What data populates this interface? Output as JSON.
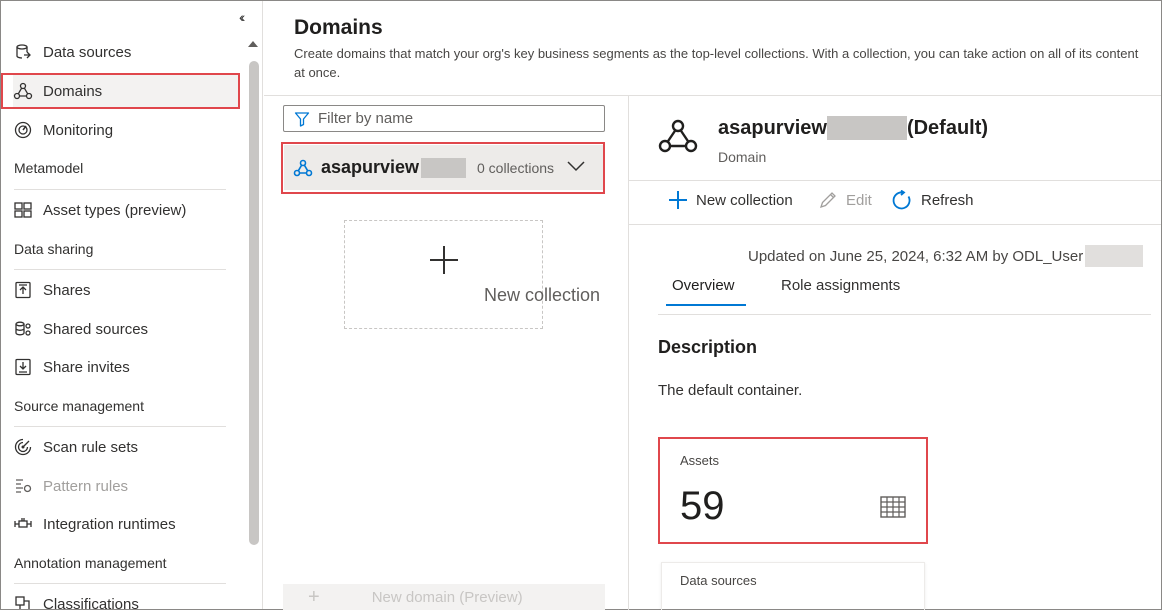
{
  "sidebar": {
    "items": [
      {
        "label": "Data sources",
        "icon": "data-sources-icon"
      },
      {
        "label": "Domains",
        "icon": "domains-icon"
      },
      {
        "label": "Monitoring",
        "icon": "monitoring-icon"
      },
      {
        "label": "Asset types (preview)",
        "icon": "asset-types-icon"
      },
      {
        "label": "Shares",
        "icon": "shares-icon"
      },
      {
        "label": "Shared sources",
        "icon": "shared-sources-icon"
      },
      {
        "label": "Share invites",
        "icon": "share-invites-icon"
      },
      {
        "label": "Scan rule sets",
        "icon": "scan-rule-sets-icon"
      },
      {
        "label": "Pattern rules",
        "icon": "pattern-rules-icon"
      },
      {
        "label": "Integration runtimes",
        "icon": "integration-runtimes-icon"
      },
      {
        "label": "Classifications",
        "icon": "classifications-icon"
      }
    ],
    "headings": {
      "metamodel": "Metamodel",
      "data_sharing": "Data sharing",
      "source_management": "Source management",
      "annotation_management": "Annotation management"
    },
    "selected": "Domains",
    "collapse_icon": "double-chevron-left-icon"
  },
  "header": {
    "title": "Domains",
    "description": "Create domains that match your org's key business segments as the top-level collections. With a collection, you can take action on all of its content at once."
  },
  "domain_list": {
    "filter_placeholder": "Filter by name",
    "domain_name": "asapurview",
    "collections_count": "0 collections",
    "new_collection": "New collection",
    "new_domain": "New domain (Preview)"
  },
  "detail": {
    "title": "asapurview",
    "title_suffix": "(Default)",
    "subtitle": "Domain",
    "toolbar": {
      "new_collection": "New collection",
      "edit": "Edit",
      "refresh": "Refresh"
    },
    "updated": "Updated on June 25, 2024, 6:32 AM by ODL_User",
    "tabs": [
      "Overview",
      "Role assignments"
    ],
    "active_tab": "Overview",
    "description_heading": "Description",
    "description_text": "The default container.",
    "assets_label": "Assets",
    "assets_count": "59",
    "data_sources_label": "Data sources"
  },
  "colors": {
    "accent": "#0078d4",
    "highlight_border": "#e0474c",
    "selected_bg": "#edebe9"
  }
}
